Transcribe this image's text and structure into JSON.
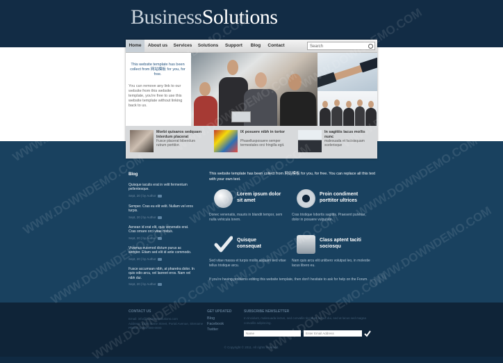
{
  "brand": {
    "part1": "Business",
    "part2": "Solutions"
  },
  "nav": [
    {
      "label": "Home"
    },
    {
      "label": "About us"
    },
    {
      "label": "Services"
    },
    {
      "label": "Solutions"
    },
    {
      "label": "Support"
    },
    {
      "label": "Blog"
    },
    {
      "label": "Contact"
    }
  ],
  "search": {
    "placeholder": "Search"
  },
  "intro": {
    "lead": "This website template has been collect from 网站模板 for you, for free.",
    "body": "You can remove any link to our website from this website template, you're free to use this website template without linking back to us."
  },
  "features": [
    {
      "title": "Morbi quisaros sedquam Interdum placerat",
      "text": "Fusce placerat bibendum rutrum porttitor."
    },
    {
      "title": "IX posuere nibh in tortor",
      "text": "Phasellusposuere semper termestales orci fringilla egit."
    },
    {
      "title": "In sagittis lacus mollis nunc",
      "text": "malesuada et facisisquam scelerisque"
    }
  ],
  "blog": {
    "heading": "Blog",
    "posts": [
      {
        "text": "Quisque iaculis erat in velit fermentum pellentesque.",
        "meta": "Sept, 20 | by Author"
      },
      {
        "text": "Semper. Cras eu elit velit. Nullam vel eros turpis.",
        "meta": "Sept, 20 | by Author"
      },
      {
        "text": "Aenean id erat elit, quis venenatis erat. Cras ornare orci vitae metus.",
        "meta": "Sept, 20 | by Author"
      },
      {
        "text": "Vivamus euismod dictum purus ac semper. Etiam sed elit id ante commodo.",
        "meta": "Sept, 20 | by Author"
      },
      {
        "text": "Fusce accumsan nibh, at pharetra dolor. In quis odio arcu, vel laoreet eros. Nam vel nibh dui.",
        "meta": "Sept, 20 | by Author"
      }
    ]
  },
  "main": {
    "lead": "This website template has been collect from 网站模板 for you, for free. You can replace all this text with your own text.",
    "services": [
      {
        "title": "Lorem ipsum dolor sit amet",
        "text": "Donec venenatis, mauris in blandit tempor, sem nulla vehicula lorem.",
        "icon": "globe-icon"
      },
      {
        "title": "Proin condiment porttitor ultrices",
        "text": "Cras tristique lobortis sagittis. Praesent pulvinar, dolor in posuere vulputate.",
        "icon": "gear-icon"
      },
      {
        "title": "Quisque consequat",
        "text": "Sed vitae massa et turpis mollis aliquam sed vitae tellus tristique arcu.",
        "icon": "check-icon"
      },
      {
        "title": "Class aptent taciti sociosqu",
        "text": "Nam quis arcu elit unlibero volutpat leo, in molestie lacus libero eu.",
        "icon": "coins-icon"
      }
    ],
    "outro": "If you're having problems editing this website template, then don't hesitate to ask for help on the Forum."
  },
  "footer": {
    "contact_heading": "CONTACT US",
    "contact_lines": [
      "Email: info@businesssolutions.com",
      "Address: 1234 Some Street, Portal Avenue, Sitename",
      "Phone: 1-800-000-0000"
    ],
    "updated_heading": "GET UPDATED",
    "updated_links": [
      "Blog",
      "Facebook",
      "Twitter"
    ],
    "newsletter_heading": "SUBSCRIBE NEWSLETTER",
    "newsletter_text": "In tincidunt, malesuada lectus, sed convallis tincidunt lectus dui, sed at lacus sed magna convallis adipiscing.",
    "name_placeholder": "Name",
    "email_placeholder": "Enter Email Address",
    "copyright": "© Copyright © 2011. All rights reserved."
  },
  "watermark": "WWW.DOWNDEMO.COM"
}
